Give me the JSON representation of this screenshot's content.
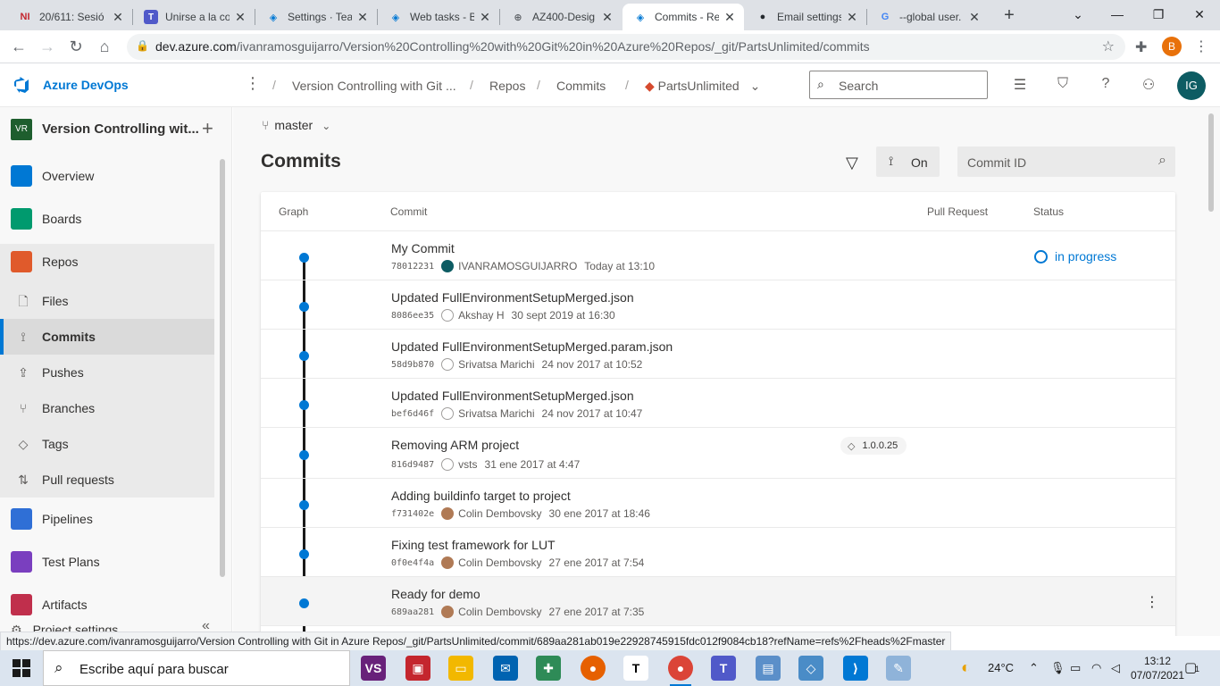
{
  "browser": {
    "tabs": [
      {
        "title": "20/611: Sesió",
        "favicon": "NI",
        "color": "#c4262e"
      },
      {
        "title": "Unirse a la co",
        "favicon": "teams-icon",
        "color": "#5059c9"
      },
      {
        "title": "Settings · Tea",
        "favicon": "azure-devops-icon",
        "color": "#0078d4"
      },
      {
        "title": "Web tasks - B",
        "favicon": "azure-devops-icon",
        "color": "#0078d4"
      },
      {
        "title": "AZ400-Desig",
        "favicon": "globe-icon",
        "color": "#5f6368"
      },
      {
        "title": "Commits - Re",
        "favicon": "azure-devops-icon",
        "color": "#0078d4"
      },
      {
        "title": "Email settings",
        "favicon": "github-icon",
        "color": "#24292e"
      },
      {
        "title": "--global user.",
        "favicon": "google-icon",
        "color": "#4285f4"
      }
    ],
    "url_host": "dev.azure.com",
    "url_path": "/ivanramosguijarro/Version%20Controlling%20with%20Git%20in%20Azure%20Repos/_git/PartsUnlimited/commits",
    "profile_initial": "B"
  },
  "header": {
    "app_name": "Azure DevOps",
    "breadcrumbs": [
      "Version Controlling with Git ...",
      "Repos",
      "Commits",
      "PartsUnlimited"
    ],
    "search_placeholder": "Search",
    "user_initials": "IG"
  },
  "sidebar": {
    "project_badge": "VR",
    "project_name": "Version Controlling wit...",
    "items": [
      {
        "label": "Overview",
        "icon": "overview-icon",
        "color": "#0078d4"
      },
      {
        "label": "Boards",
        "icon": "boards-icon",
        "color": "#009a6e"
      },
      {
        "label": "Repos",
        "icon": "repos-icon",
        "color": "#e05a2b"
      },
      {
        "label": "Files",
        "icon": "file-icon"
      },
      {
        "label": "Commits",
        "icon": "commit-icon"
      },
      {
        "label": "Pushes",
        "icon": "push-icon"
      },
      {
        "label": "Branches",
        "icon": "branch-icon"
      },
      {
        "label": "Tags",
        "icon": "tag-icon"
      },
      {
        "label": "Pull requests",
        "icon": "pull-request-icon"
      },
      {
        "label": "Pipelines",
        "icon": "pipelines-icon",
        "color": "#2f6fd6"
      },
      {
        "label": "Test Plans",
        "icon": "test-plans-icon",
        "color": "#7a3fbf"
      },
      {
        "label": "Artifacts",
        "icon": "artifacts-icon",
        "color": "#c02f4c"
      }
    ],
    "project_settings": "Project settings"
  },
  "main": {
    "branch": "master",
    "title": "Commits",
    "graph_toggle_label": "On",
    "commit_search_placeholder": "Commit ID",
    "columns": {
      "graph": "Graph",
      "commit": "Commit",
      "pull_request": "Pull Request",
      "status": "Status"
    },
    "commits": [
      {
        "message": "My Commit",
        "hash": "78012231",
        "author": "IVANRAMOSGUIJARRO",
        "date": "Today at 13:10",
        "avatar": "ig",
        "tag": "",
        "status": "in progress"
      },
      {
        "message": "Updated FullEnvironmentSetupMerged.json",
        "hash": "8086ee35",
        "author": "Akshay H",
        "date": "30 sept 2019 at 16:30",
        "avatar": "ph",
        "tag": "",
        "status": ""
      },
      {
        "message": "Updated FullEnvironmentSetupMerged.param.json",
        "hash": "58d9b870",
        "author": "Srivatsa Marichi",
        "date": "24 nov 2017 at 10:52",
        "avatar": "ph",
        "tag": "",
        "status": ""
      },
      {
        "message": "Updated FullEnvironmentSetupMerged.json",
        "hash": "bef6d46f",
        "author": "Srivatsa Marichi",
        "date": "24 nov 2017 at 10:47",
        "avatar": "ph",
        "tag": "",
        "status": ""
      },
      {
        "message": "Removing ARM project",
        "hash": "816d9487",
        "author": "vsts",
        "date": "31 ene 2017 at 4:47",
        "avatar": "ph",
        "tag": "1.0.0.25",
        "status": ""
      },
      {
        "message": "Adding buildinfo target to project",
        "hash": "f731402e",
        "author": "Colin Dembovsky",
        "date": "30 ene 2017 at 18:46",
        "avatar": "cd",
        "tag": "",
        "status": ""
      },
      {
        "message": "Fixing test framework for LUT",
        "hash": "0f0e4f4a",
        "author": "Colin Dembovsky",
        "date": "27 ene 2017 at 7:54",
        "avatar": "cd",
        "tag": "",
        "status": ""
      },
      {
        "message": "Ready for demo",
        "hash": "689aa281",
        "author": "Colin Dembovsky",
        "date": "27 ene 2017 at 7:35",
        "avatar": "cd",
        "tag": "",
        "status": ""
      }
    ],
    "link_preview": "https://dev.azure.com/ivanramosguijarro/Version Controlling with Git in Azure Repos/_git/PartsUnlimited/commit/689aa281ab019e22928745915fdc012f9084cb18?refName=refs%2Fheads%2Fmaster"
  },
  "taskbar": {
    "search_placeholder": "Escribe aquí para buscar",
    "temperature": "24°C",
    "time": "13:12",
    "date": "07/07/2021",
    "notification_count": "1"
  }
}
